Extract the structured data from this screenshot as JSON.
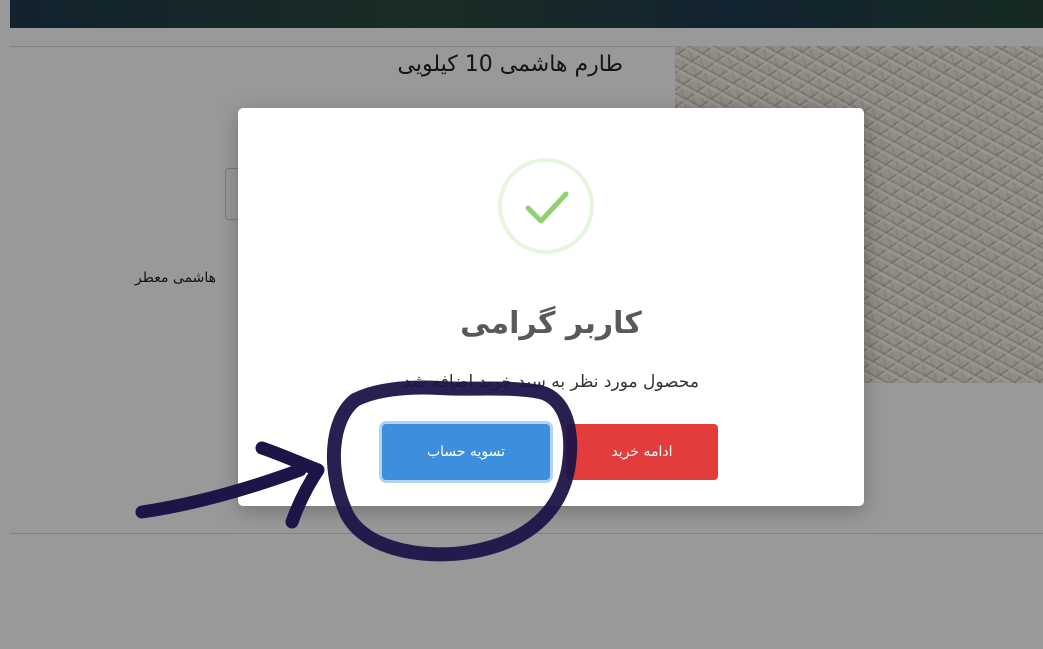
{
  "product": {
    "title": "طارم هاشمی 10 کیلویی",
    "description": "هاشمی معطر"
  },
  "modal": {
    "title": "کاربر گرامی",
    "message": "محصول مورد نظر به سبد خرید اضافه شد",
    "checkout_label": "تسویه حساب",
    "continue_label": "ادامه خرید",
    "success_icon": "check-icon"
  },
  "colors": {
    "continue_button": "#e23c3c",
    "checkout_button": "#3d8fde",
    "success_check": "#8fd16a",
    "annotation_ink": "#1d1448"
  }
}
